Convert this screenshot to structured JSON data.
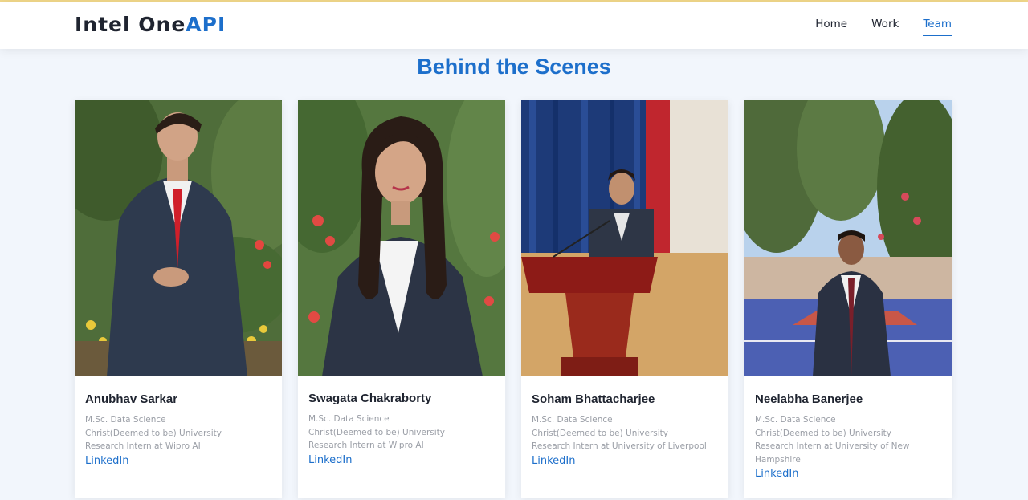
{
  "header": {
    "logo_main": "Intel One",
    "logo_accent": "API",
    "nav": [
      {
        "label": "Home"
      },
      {
        "label": "Work"
      },
      {
        "label": "Team"
      }
    ]
  },
  "section_title": "Behind the Scenes",
  "team": [
    {
      "name": "Anubhav Sarkar",
      "degree": "M.Sc. Data Science",
      "university": "Christ(Deemed to be) University",
      "role": "Research Intern at Wipro AI",
      "link_label": "LinkedIn"
    },
    {
      "name": "Swagata Chakraborty",
      "degree": "M.Sc. Data Science",
      "university": "Christ(Deemed to be) University",
      "role": "Research Intern at Wipro AI",
      "link_label": "LinkedIn"
    },
    {
      "name": "Soham Bhattacharjee",
      "degree": "M.Sc. Data Science",
      "university": "Christ(Deemed to be) University",
      "role": "Research Intern at University of Liverpool",
      "link_label": "LinkedIn"
    },
    {
      "name": "Neelabha Banerjee",
      "degree": "M.Sc. Data Science",
      "university": "Christ(Deemed to be) University",
      "role": "Research Intern at University of New Hampshire",
      "link_label": "LinkedIn"
    }
  ],
  "colors": {
    "accent": "#1d6fcb",
    "page_background": "#f2f6fc",
    "text_dark": "#1f2430",
    "text_muted": "#9a9ea6"
  }
}
